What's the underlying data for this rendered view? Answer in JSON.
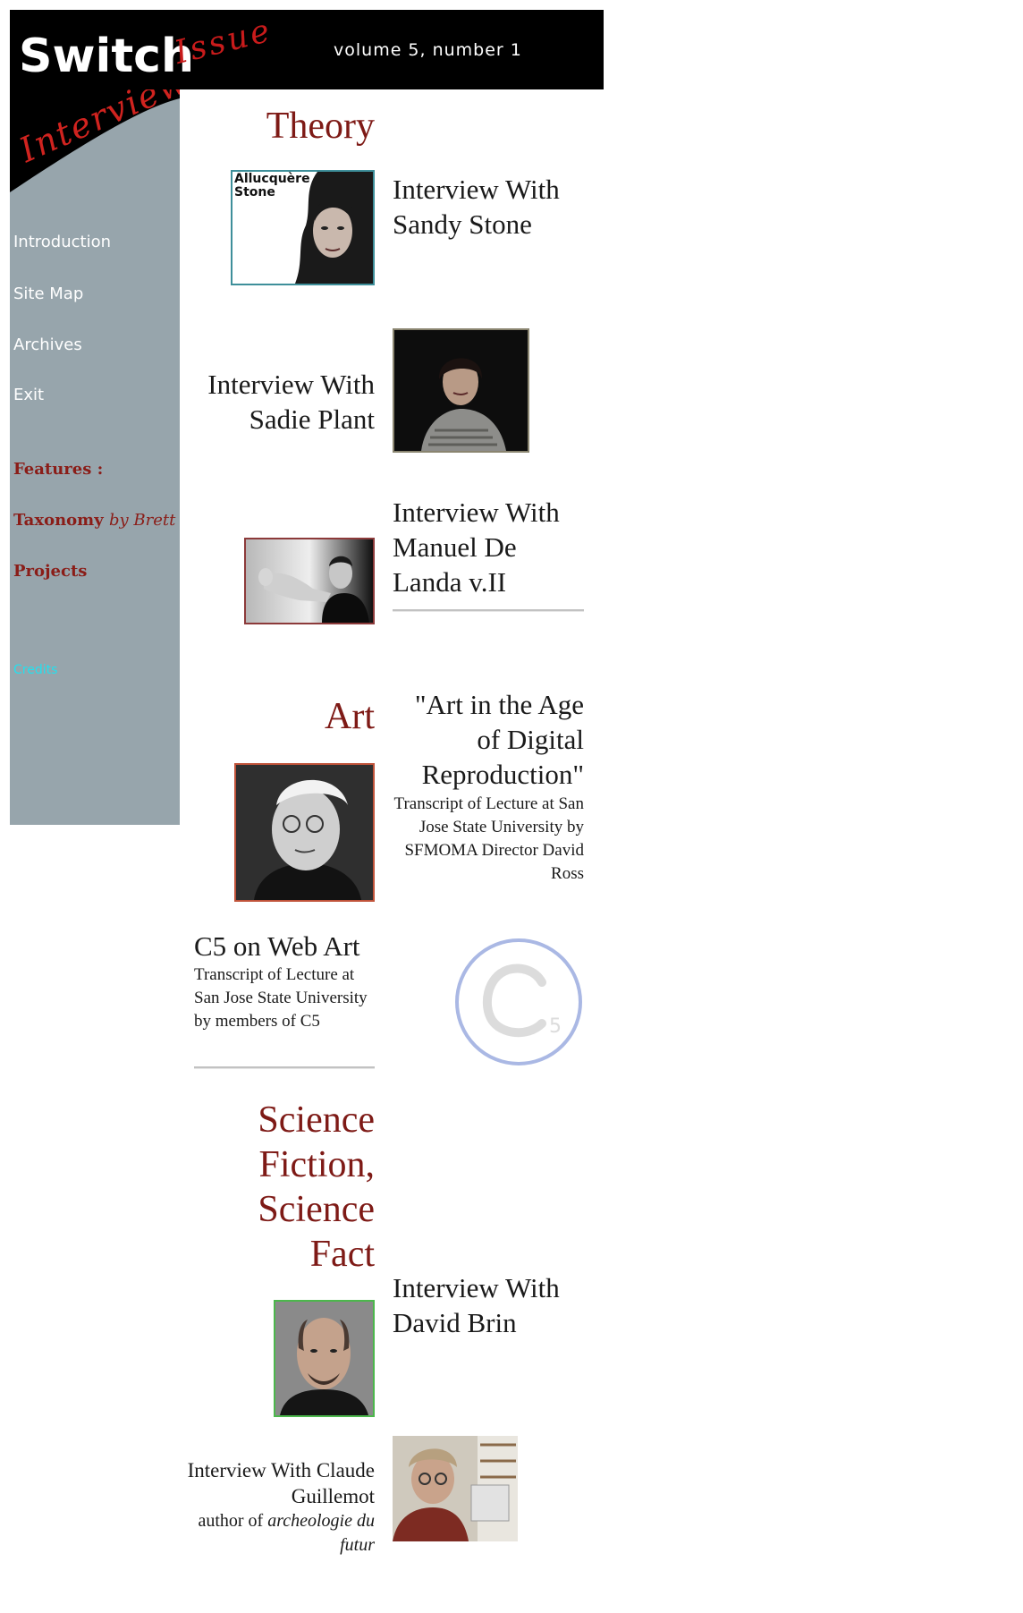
{
  "header": {
    "logo": "Switch",
    "issue_script": "Issue",
    "volume": "volume 5, number 1"
  },
  "sidebar": {
    "interview_script": "Interview",
    "nav": [
      "Introduction",
      "Site Map",
      "Archives",
      "Exit"
    ],
    "features_label": "Features :",
    "taxonomy": "Taxonomy",
    "taxonomy_by": "by Brett",
    "projects": "Projects",
    "credits": "Credits"
  },
  "theory": {
    "heading": "Theory",
    "stone_photo_caption": "Allucquère Stone",
    "items": [
      {
        "title": "Interview With Sandy Stone"
      },
      {
        "title": "Interview With Sadie Plant"
      },
      {
        "title": "Interview With Manuel De Landa v.II"
      }
    ]
  },
  "art": {
    "heading": "Art",
    "ross": {
      "title": "\"Art in the Age of Digital Reproduction\"",
      "desc": "Transcript of Lecture at San Jose State University by SFMOMA Director David Ross"
    },
    "c5": {
      "title": "C5 on Web Art",
      "desc": "Transcript of Lecture at San Jose State University by members of C5",
      "logo_text": "C5"
    }
  },
  "scifi": {
    "heading_lines": [
      "Science",
      "Fiction,",
      "Science",
      "Fact"
    ],
    "brin": {
      "title": "Interview With David Brin"
    },
    "guillemot": {
      "title": "Interview With Claude Guillemot",
      "author_prefix": "author of",
      "book": "archeologie du futur"
    }
  },
  "colors": {
    "banner": "#000000",
    "sidebar": "#97a5ac",
    "section_heading": "#7e1a16",
    "script_red": "#c81b1b",
    "credits": "#24e0ee"
  }
}
